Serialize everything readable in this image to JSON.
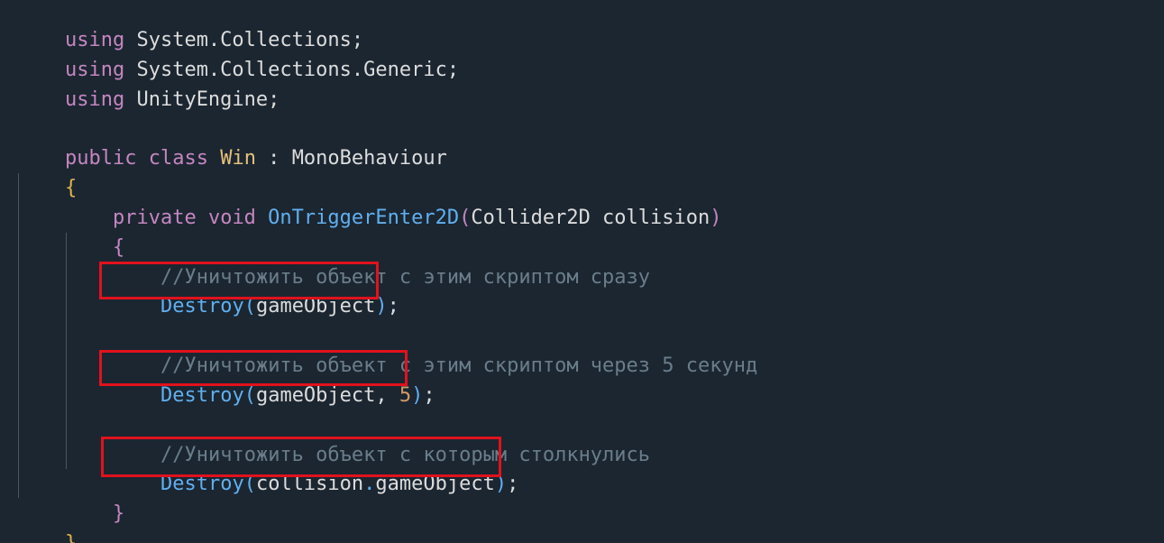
{
  "code": {
    "l1_kw": "using",
    "l1_rest": " System.Collections",
    "l1_semi": ";",
    "l2_kw": "using",
    "l2_rest": " System.Collections.Generic",
    "l2_semi": ";",
    "l3_kw": "using",
    "l3_rest": " UnityEngine",
    "l3_semi": ";",
    "l5_kw1": "public",
    "l5_kw2": " class",
    "l5_cls": " Win",
    "l5_colon": " : ",
    "l5_base": "MonoBehaviour",
    "l6_brace": "{",
    "l7_kw1": "private",
    "l7_kw2": " void",
    "l7_fn": " OnTriggerEnter2D",
    "l7_open": "(",
    "l7_params": "Collider2D collision",
    "l7_close": ")",
    "l8_brace": "{",
    "l9_comment": "//Уничтожить объект с этим скриптом сразу",
    "l10_fn": "Destroy",
    "l10_open": "(",
    "l10_arg": "gameObject",
    "l10_close": ")",
    "l10_semi": ";",
    "l12_comment": "//Уничтожить объект с этим скриптом через 5 секунд",
    "l13_fn": "Destroy",
    "l13_open": "(",
    "l13_arg": "gameObject, ",
    "l13_num": "5",
    "l13_close": ")",
    "l13_semi": ";",
    "l15_comment": "//Уничтожить объект с которым столкнулись",
    "l16_fn": "Destroy",
    "l16_open": "(",
    "l16_arg1": "collision",
    "l16_dot": ".",
    "l16_arg2": "gameObject",
    "l16_close": ")",
    "l16_semi": ";",
    "l17_brace": "}",
    "l18_brace": "}"
  },
  "colors": {
    "background": "#1b2631",
    "keyword": "#c586c0",
    "class_name": "#e5c07b",
    "function": "#61afef",
    "comment": "#6a7d8a",
    "highlight_box": "#e0121d"
  }
}
